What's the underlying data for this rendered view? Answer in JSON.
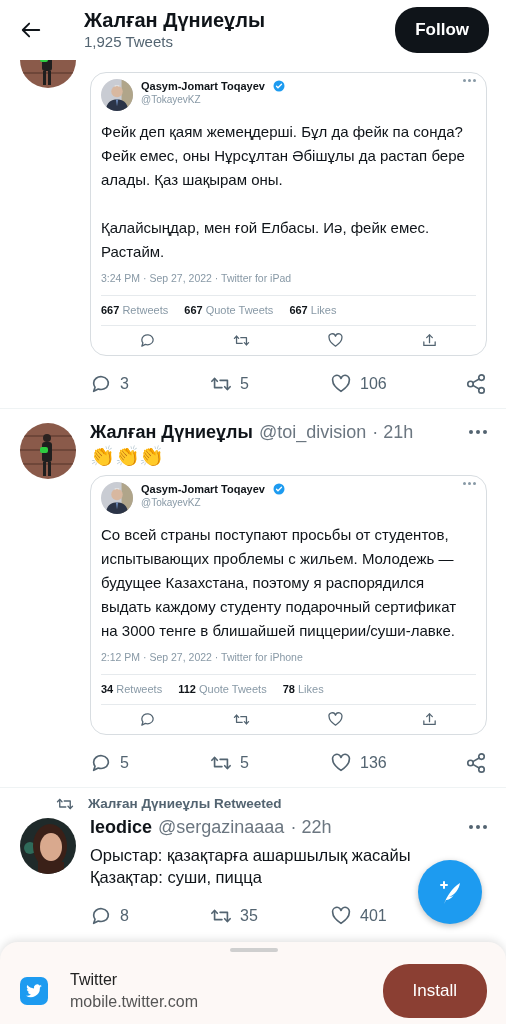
{
  "header": {
    "title": "Жалған Дүниеұлы",
    "subtitle": "1,925 Tweets",
    "follow_button": "Follow"
  },
  "tweets": [
    {
      "quote": {
        "author": "Qasym-Jomart Toqayev",
        "verified": true,
        "handle": "@TokayevKZ",
        "paragraphs": [
          "Фейк деп қаям жемеңдерші. Бұл да фейк па сонда? Фейк емес, оны Нұрсұлтан Әбішұлы да растап бере алады. Қаз шақырам оны.",
          "Қалайсыңдар, мен ғой Елбасы. Иә, фейк емес. Растайм."
        ],
        "meta": "3:24 PM · Sep 27, 2022 · Twitter for iPad",
        "stats": [
          {
            "count": "667",
            "label": "Retweets"
          },
          {
            "count": "667",
            "label": "Quote Tweets"
          },
          {
            "count": "667",
            "label": "Likes"
          }
        ]
      },
      "actions": {
        "replies": "3",
        "retweets": "5",
        "likes": "106"
      }
    },
    {
      "author": "Жалған Дүниеұлы",
      "handle": "@toi_division",
      "time": "· 21h",
      "text": "👏👏👏",
      "quote": {
        "author": "Qasym-Jomart Toqayev",
        "verified": true,
        "handle": "@TokayevKZ",
        "paragraphs": [
          "Со всей страны поступают просьбы от студентов, испытывающих проблемы с жильем. Молодежь — будущее Казахстана, поэтому я распорядился выдать каждому студенту подарочный сертификат на 3000 тенге в блишайшей пиццерии/суши-лавке."
        ],
        "meta": "2:12 PM · Sep 27, 2022 · Twitter for iPhone",
        "stats": [
          {
            "count": "34",
            "label": "Retweets"
          },
          {
            "count": "112",
            "label": "Quote Tweets"
          },
          {
            "count": "78",
            "label": "Likes"
          }
        ]
      },
      "actions": {
        "replies": "5",
        "retweets": "5",
        "likes": "136"
      }
    },
    {
      "social_context": "Жалған Дүниеұлы Retweeted",
      "author": "leodice",
      "handle": "@sergazinaaaa",
      "time": "· 22h",
      "text_lines": [
        "Орыстар: қазақтарға ашаршылық жасайы",
        "Қазақтар: суши, пицца"
      ],
      "actions": {
        "replies": "8",
        "retweets": "35",
        "likes": "401"
      }
    }
  ],
  "install_banner": {
    "app_name": "Twitter",
    "url": "mobile.twitter.com",
    "install_button": "Install"
  }
}
